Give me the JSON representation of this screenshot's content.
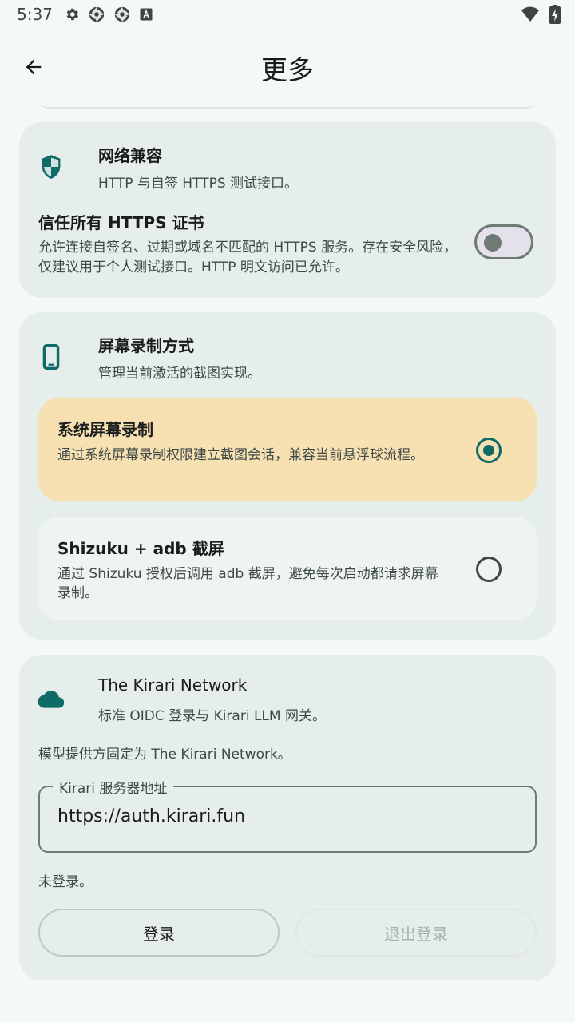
{
  "status_bar": {
    "time": "5:37",
    "left_icons": [
      "settings-icon",
      "aperture-icon",
      "aperture-icon",
      "font-icon"
    ],
    "right_icons": [
      "wifi-icon",
      "battery-charging-icon"
    ]
  },
  "app_bar": {
    "back_icon": "arrow-back-icon",
    "title": "更多"
  },
  "network_card": {
    "icon": "shield-icon",
    "title": "网络兼容",
    "subtitle": "HTTP 与自签 HTTPS 测试接口。",
    "setting": {
      "title": "信任所有 HTTPS 证书",
      "description": "允许连接自签名、过期或域名不匹配的 HTTPS 服务。存在安全风险，仅建议用于个人测试接口。HTTP 明文访问已允许。",
      "enabled": false
    }
  },
  "capture_card": {
    "icon": "smartphone-icon",
    "title": "屏幕录制方式",
    "subtitle": "管理当前激活的截图实现。",
    "options": [
      {
        "title": "系统屏幕录制",
        "description": "通过系统屏幕录制权限建立截图会话，兼容当前悬浮球流程。",
        "selected": true
      },
      {
        "title": "Shizuku + adb 截屏",
        "description": "通过 Shizuku 授权后调用 adb 截屏，避免每次启动都请求屏幕录制。",
        "selected": false
      }
    ]
  },
  "kirari_card": {
    "icon": "cloud-icon",
    "title": "The Kirari Network",
    "subtitle": "标准 OIDC 登录与 Kirari LLM 网关。",
    "provider_note": "模型提供方固定为 The Kirari Network。",
    "server_field": {
      "label": "Kirari 服务器地址",
      "value": "https://auth.kirari.fun"
    },
    "login_status": "未登录。",
    "login_button": "登录",
    "logout_button": "退出登录"
  },
  "colors": {
    "accent": "#0f6b66",
    "selected_option_bg": "#f7e1b3",
    "card_bg": "#e6eeeb",
    "page_bg": "#f4f8f6"
  }
}
